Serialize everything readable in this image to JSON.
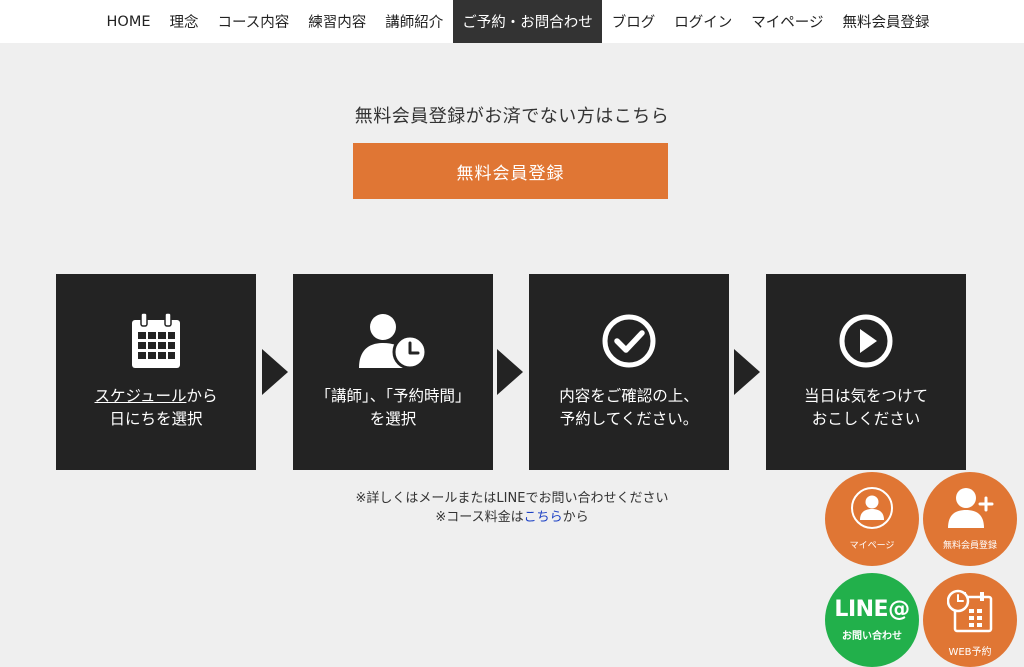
{
  "nav": {
    "items": [
      {
        "label": "HOME"
      },
      {
        "label": "理念"
      },
      {
        "label": "コース内容"
      },
      {
        "label": "練習内容"
      },
      {
        "label": "講師紹介"
      },
      {
        "label": "ご予約・お問合わせ"
      },
      {
        "label": "ブログ"
      },
      {
        "label": "ログイン"
      },
      {
        "label": "マイページ"
      },
      {
        "label": "無料会員登録"
      }
    ],
    "active_index": 5,
    "active_bg": "#333333"
  },
  "registration": {
    "prompt": "無料会員登録がお済でない方はこちら",
    "button_label": "無料会員登録",
    "button_color": "#e07634"
  },
  "steps": [
    {
      "icon": "calendar-icon",
      "link_text": "スケジュール",
      "line1_rest": "から",
      "line2": "日にちを選択"
    },
    {
      "icon": "user-clock-icon",
      "line1": "「講師」、「予約時間」",
      "line2": "を選択"
    },
    {
      "icon": "check-circle-icon",
      "line1": "内容をご確認の上、",
      "line2": "予約してください。"
    },
    {
      "icon": "play-circle-icon",
      "line1": "当日は気をつけて",
      "line2": "おこしください"
    }
  ],
  "notes": {
    "line1": "※詳しくはメールまたはLINEでお問い合わせください",
    "line2_prefix": "※コース料金は",
    "line2_link": "こちら",
    "line2_suffix": "から"
  },
  "floating": {
    "mypage_label": "マイページ",
    "register_label": "無料会員登録",
    "line_logo": "LINE@",
    "line_label": "お問い合わせ",
    "web_label": "WEB予約",
    "orange": "#e07634",
    "green": "#22b04b"
  }
}
